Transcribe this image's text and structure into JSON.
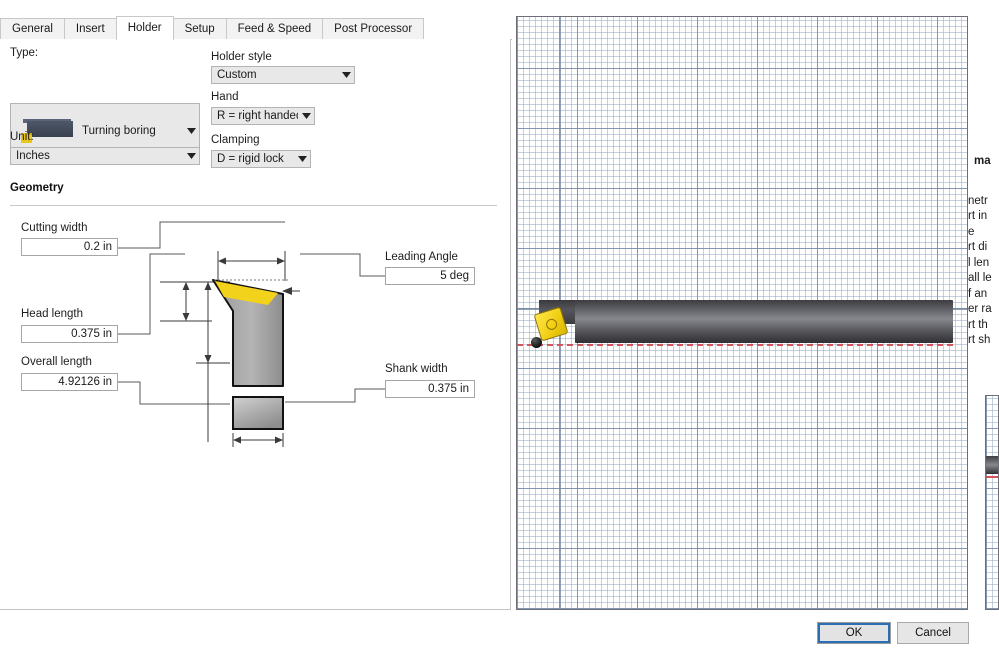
{
  "tabs": [
    {
      "label": "General",
      "active": false
    },
    {
      "label": "Insert",
      "active": false
    },
    {
      "label": "Holder",
      "active": true
    },
    {
      "label": "Setup",
      "active": false
    },
    {
      "label": "Feed & Speed",
      "active": false
    },
    {
      "label": "Post Processor",
      "active": false
    }
  ],
  "left": {
    "type_label": "Type:",
    "type_value": "Turning boring",
    "unit_label": "Unit:",
    "unit_value": "Inches",
    "holder_style_label": "Holder style",
    "holder_style_value": "Custom",
    "hand_label": "Hand",
    "hand_value": "R = right handed",
    "clamping_label": "Clamping",
    "clamping_value": "D = rigid lock",
    "geometry_title": "Geometry",
    "fields": {
      "cutting_width_label": "Cutting width",
      "cutting_width_value": "0.2 in",
      "head_length_label": "Head length",
      "head_length_value": "0.375 in",
      "overall_length_label": "Overall length",
      "overall_length_value": "4.92126 in",
      "leading_angle_label": "Leading Angle",
      "leading_angle_value": "5 deg",
      "shank_width_label": "Shank width",
      "shank_width_value": "0.375 in"
    }
  },
  "background_panel": {
    "lines": [
      "ma",
      "netr",
      "rt in",
      "e",
      "rt di",
      "l len",
      "all le",
      "f an",
      "er ra",
      "rt th",
      "rt sh"
    ]
  },
  "buttons": {
    "ok": "OK",
    "cancel": "Cancel"
  },
  "colors": {
    "insert_yellow": "#f2cf15",
    "shank_gray": "#6f7076",
    "centerline_red": "#d0555f",
    "focus_blue": "#2a6fb5",
    "grid_blue": "#96aac3"
  }
}
